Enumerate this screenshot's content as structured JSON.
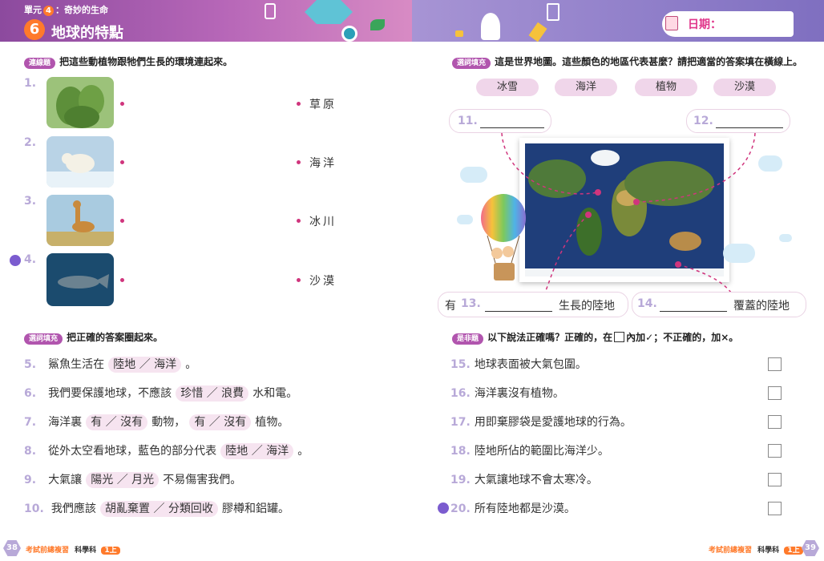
{
  "header": {
    "unit_prefix": "單元",
    "unit_number": "4",
    "unit_name": "：奇妙的生命",
    "lesson_number": "6",
    "lesson_title": "地球的特點",
    "date_label": "日期："
  },
  "section1": {
    "tag": "連線題",
    "instruction": "把這些動植物跟牠們生長的環境連起來。",
    "items": [
      {
        "number": "1.",
        "image": "cactus"
      },
      {
        "number": "2.",
        "image": "polar-bear"
      },
      {
        "number": "3.",
        "image": "giraffe"
      },
      {
        "number": "4.",
        "image": "whale"
      }
    ],
    "environments": [
      "草原",
      "海洋",
      "冰川",
      "沙漠"
    ]
  },
  "section2": {
    "tag": "選詞填充",
    "instruction": "把正確的答案圈起來。",
    "questions": [
      {
        "number": "5.",
        "before": "鯊魚生活在",
        "options": "陸地 ／ 海洋",
        "after": "。"
      },
      {
        "number": "6.",
        "before": "我們要保護地球，不應該",
        "options": "珍惜 ／ 浪費",
        "after": "水和電。"
      },
      {
        "number": "7.",
        "before": "海洋裏",
        "options": "有 ／ 沒有",
        "middle": "動物，",
        "options2": "有 ／ 沒有",
        "after": "植物。"
      },
      {
        "number": "8.",
        "before": "從外太空看地球，藍色的部分代表",
        "options": "陸地 ／ 海洋",
        "after": "。"
      },
      {
        "number": "9.",
        "before": "大氣讓",
        "options": "陽光 ／ 月光",
        "after": "不易傷害我們。"
      },
      {
        "number": "10.",
        "before": "我們應該",
        "options": "胡亂棄置 ／ 分類回收",
        "after": "膠樽和鋁罐。"
      }
    ]
  },
  "section3": {
    "tag": "選詞填充",
    "instruction": "這是世界地圖。這些顏色的地區代表甚麼？請把適當的答案填在橫線上。",
    "word_bank": [
      "冰雪",
      "海洋",
      "植物",
      "沙漠"
    ],
    "q11": "11.",
    "q12": "12.",
    "q13_prefix": "有",
    "q13": "13.",
    "q13_suffix": "生長的陸地",
    "q14": "14.",
    "q14_suffix": "覆蓋的陸地"
  },
  "section4": {
    "tag": "是非題",
    "instruction_a": "以下說法正確嗎？正確的，在",
    "instruction_b": "內加",
    "check_mark": "✓",
    "instruction_c": "；不正確的，加",
    "cross_mark": "×",
    "instruction_d": "。",
    "statements": [
      {
        "number": "15.",
        "text": "地球表面被大氣包圍。"
      },
      {
        "number": "16.",
        "text": "海洋裏沒有植物。"
      },
      {
        "number": "17.",
        "text": "用即棄膠袋是愛護地球的行為。"
      },
      {
        "number": "18.",
        "text": "陸地所佔的範圍比海洋少。"
      },
      {
        "number": "19.",
        "text": "大氣讓地球不會太寒冷。"
      },
      {
        "number": "20.",
        "text": "所有陸地都是沙漠。"
      }
    ]
  },
  "footer": {
    "left_page": "38",
    "right_page": "39",
    "series": "考試前總複習",
    "subject": "科學科",
    "grade": "1上"
  },
  "colors": {
    "accent_pink": "#d0357d",
    "tag_purple": "#b155ae",
    "number_lavender": "#b8a9d8",
    "orange": "#ff7a2b"
  }
}
